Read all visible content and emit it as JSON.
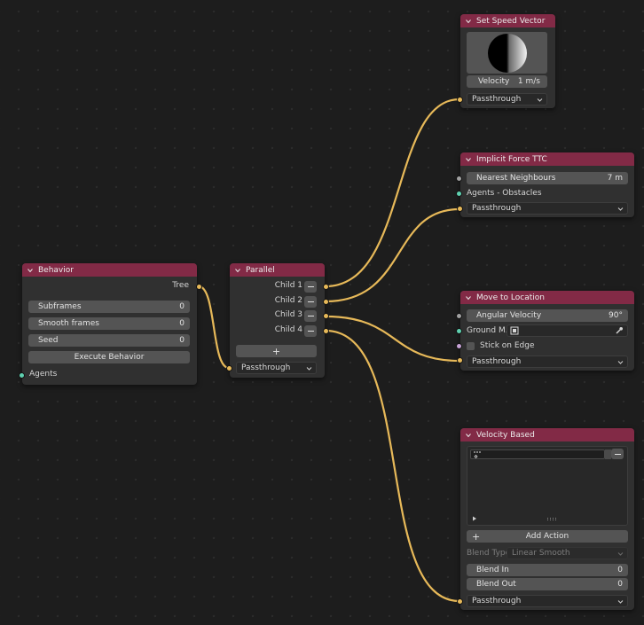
{
  "nodes": {
    "behavior": {
      "title": "Behavior",
      "output_label": "Tree",
      "fields": [
        {
          "label": "Subframes",
          "value": "0"
        },
        {
          "label": "Smooth frames",
          "value": "0"
        },
        {
          "label": "Seed",
          "value": "0"
        }
      ],
      "execute_label": "Execute Behavior",
      "input_label": "Agents"
    },
    "parallel": {
      "title": "Parallel",
      "children": [
        "Child 1",
        "Child 2",
        "Child 3",
        "Child 4"
      ],
      "add_symbol": "+",
      "mode": "Passthrough"
    },
    "set_speed_vector": {
      "title": "Set Speed Vector",
      "velocity_label": "Velocity",
      "velocity_value": "1 m/s",
      "mode": "Passthrough"
    },
    "implicit_force": {
      "title": "Implicit Force TTC",
      "nearest_label": "Nearest Neighbours",
      "nearest_value": "7 m",
      "agents_label": "Agents - Obstacles",
      "mode": "Passthrough"
    },
    "move_to_location": {
      "title": "Move to Location",
      "angular_label": "Angular Velocity",
      "angular_value": "90°",
      "ground_label": "Ground M...",
      "stick_label": "Stick on Edge",
      "mode": "Passthrough"
    },
    "velocity_based": {
      "title": "Velocity Based",
      "add_action_label": "Add Action",
      "blend_type_label": "Blend Type",
      "blend_type_value": "Linear Smooth",
      "blend_in_label": "Blend In",
      "blend_in_value": "0",
      "blend_out_label": "Blend Out",
      "blend_out_value": "0",
      "mode": "Passthrough"
    }
  },
  "colors": {
    "background": "#1d1d1d",
    "node_body": "#303030",
    "node_header": "#822a46",
    "wire": "#e7b959",
    "socket_yellow": "#e7b959",
    "socket_green": "#5fd1b0",
    "socket_gray": "#a1a1a1"
  }
}
